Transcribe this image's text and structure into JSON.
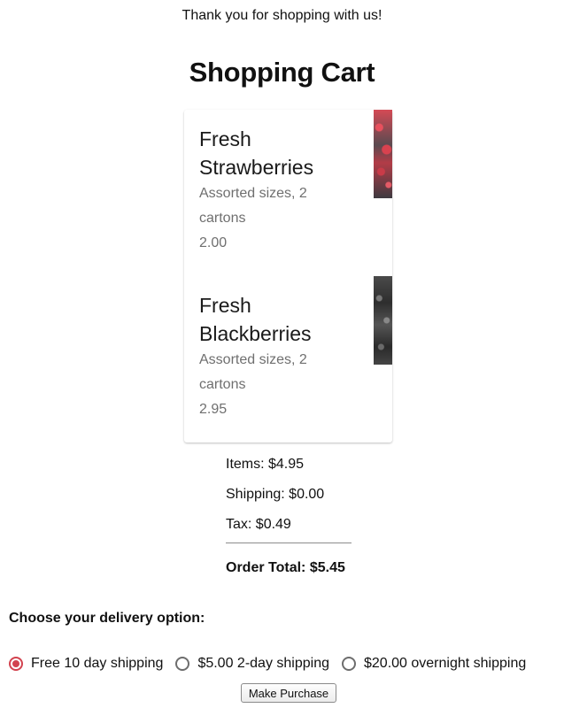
{
  "header": {
    "thanks_text": "Thank you for shopping with us!",
    "title": "Shopping Cart"
  },
  "cart": {
    "items": [
      {
        "name": "Fresh Strawberries",
        "description": "Assorted sizes, 2 cartons",
        "price": "2.00",
        "image_icon": "strawberries-image"
      },
      {
        "name": "Fresh Blackberries",
        "description": "Assorted sizes, 2 cartons",
        "price": "2.95",
        "image_icon": "blackberries-image"
      }
    ]
  },
  "summary": {
    "items": "Items: $4.95",
    "shipping": "Shipping: $0.00",
    "tax": "Tax: $0.49",
    "total": "Order Total: $5.45"
  },
  "delivery": {
    "label": "Choose your delivery option:",
    "options": [
      {
        "label": "Free 10 day shipping",
        "selected": true
      },
      {
        "label": "$5.00 2-day shipping",
        "selected": false
      },
      {
        "label": "$20.00 overnight shipping",
        "selected": false
      }
    ]
  },
  "actions": {
    "purchase_label": "Make Purchase"
  },
  "colors": {
    "accent": "#d2434f",
    "muted_text": "#6f6f6f"
  }
}
